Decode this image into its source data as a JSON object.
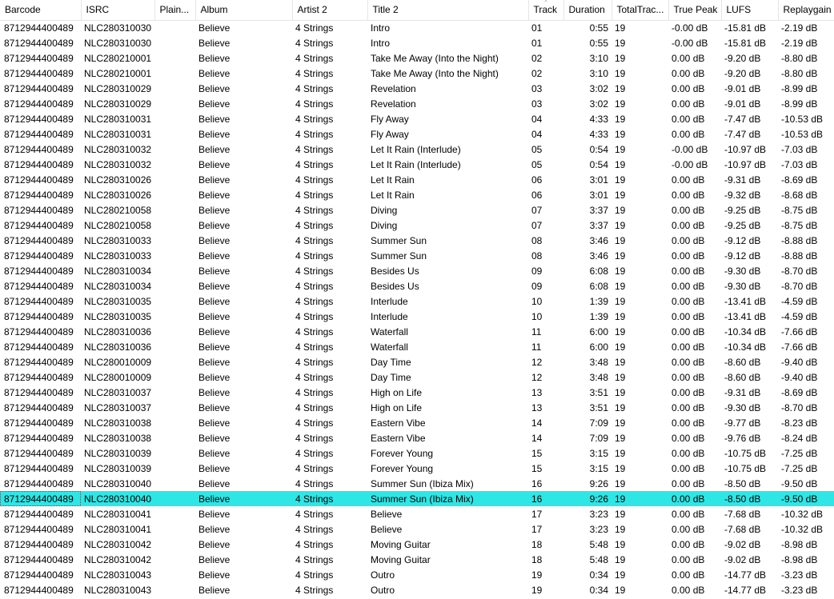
{
  "columns": [
    {
      "key": "barcode",
      "label": "Barcode",
      "width": 101
    },
    {
      "key": "isrc",
      "label": "ISRC",
      "width": 92
    },
    {
      "key": "plain",
      "label": "Plain...",
      "width": 51
    },
    {
      "key": "album",
      "label": "Album",
      "width": 121
    },
    {
      "key": "artist2",
      "label": "Artist 2",
      "width": 94
    },
    {
      "key": "title2",
      "label": "Title 2",
      "width": 201
    },
    {
      "key": "track",
      "label": "Track",
      "width": 44,
      "sorted": true,
      "sort_glyph": "^"
    },
    {
      "key": "duration",
      "label": "Duration",
      "width": 60
    },
    {
      "key": "totaltracks",
      "label": "TotalTrac...",
      "width": 71
    },
    {
      "key": "truepeak",
      "label": "True Peak",
      "width": 66
    },
    {
      "key": "lufs",
      "label": "LUFS",
      "width": 71
    },
    {
      "key": "replaygain",
      "label": "Replaygain",
      "width": 70
    }
  ],
  "selected_row": 31,
  "rows": [
    [
      "8712944400489",
      "NLC280310030",
      "",
      "Believe",
      "4 Strings",
      "Intro",
      "01",
      "0:55",
      "19",
      "-0.00 dB",
      "-15.81 dB",
      "-2.19 dB"
    ],
    [
      "8712944400489",
      "NLC280310030",
      "",
      "Believe",
      "4 Strings",
      "Intro",
      "01",
      "0:55",
      "19",
      "-0.00 dB",
      "-15.81 dB",
      "-2.19 dB"
    ],
    [
      "8712944400489",
      "NLC280210001",
      "",
      "Believe",
      "4 Strings",
      "Take Me Away (Into the Night)",
      "02",
      "3:10",
      "19",
      "0.00 dB",
      "-9.20 dB",
      "-8.80 dB"
    ],
    [
      "8712944400489",
      "NLC280210001",
      "",
      "Believe",
      "4 Strings",
      "Take Me Away (Into the Night)",
      "02",
      "3:10",
      "19",
      "0.00 dB",
      "-9.20 dB",
      "-8.80 dB"
    ],
    [
      "8712944400489",
      "NLC280310029",
      "",
      "Believe",
      "4 Strings",
      "Revelation",
      "03",
      "3:02",
      "19",
      "0.00 dB",
      "-9.01 dB",
      "-8.99 dB"
    ],
    [
      "8712944400489",
      "NLC280310029",
      "",
      "Believe",
      "4 Strings",
      "Revelation",
      "03",
      "3:02",
      "19",
      "0.00 dB",
      "-9.01 dB",
      "-8.99 dB"
    ],
    [
      "8712944400489",
      "NLC280310031",
      "",
      "Believe",
      "4 Strings",
      "Fly Away",
      "04",
      "4:33",
      "19",
      "0.00 dB",
      "-7.47 dB",
      "-10.53 dB"
    ],
    [
      "8712944400489",
      "NLC280310031",
      "",
      "Believe",
      "4 Strings",
      "Fly Away",
      "04",
      "4:33",
      "19",
      "0.00 dB",
      "-7.47 dB",
      "-10.53 dB"
    ],
    [
      "8712944400489",
      "NLC280310032",
      "",
      "Believe",
      "4 Strings",
      "Let It Rain (Interlude)",
      "05",
      "0:54",
      "19",
      "-0.00 dB",
      "-10.97 dB",
      "-7.03 dB"
    ],
    [
      "8712944400489",
      "NLC280310032",
      "",
      "Believe",
      "4 Strings",
      "Let It Rain (Interlude)",
      "05",
      "0:54",
      "19",
      "-0.00 dB",
      "-10.97 dB",
      "-7.03 dB"
    ],
    [
      "8712944400489",
      "NLC280310026",
      "",
      "Believe",
      "4 Strings",
      "Let It Rain",
      "06",
      "3:01",
      "19",
      "0.00 dB",
      "-9.31 dB",
      "-8.69 dB"
    ],
    [
      "8712944400489",
      "NLC280310026",
      "",
      "Believe",
      "4 Strings",
      "Let It Rain",
      "06",
      "3:01",
      "19",
      "0.00 dB",
      "-9.32 dB",
      "-8.68 dB"
    ],
    [
      "8712944400489",
      "NLC280210058",
      "",
      "Believe",
      "4 Strings",
      "Diving",
      "07",
      "3:37",
      "19",
      "0.00 dB",
      "-9.25 dB",
      "-8.75 dB"
    ],
    [
      "8712944400489",
      "NLC280210058",
      "",
      "Believe",
      "4 Strings",
      "Diving",
      "07",
      "3:37",
      "19",
      "0.00 dB",
      "-9.25 dB",
      "-8.75 dB"
    ],
    [
      "8712944400489",
      "NLC280310033",
      "",
      "Believe",
      "4 Strings",
      "Summer Sun",
      "08",
      "3:46",
      "19",
      "0.00 dB",
      "-9.12 dB",
      "-8.88 dB"
    ],
    [
      "8712944400489",
      "NLC280310033",
      "",
      "Believe",
      "4 Strings",
      "Summer Sun",
      "08",
      "3:46",
      "19",
      "0.00 dB",
      "-9.12 dB",
      "-8.88 dB"
    ],
    [
      "8712944400489",
      "NLC280310034",
      "",
      "Believe",
      "4 Strings",
      "Besides Us",
      "09",
      "6:08",
      "19",
      "0.00 dB",
      "-9.30 dB",
      "-8.70 dB"
    ],
    [
      "8712944400489",
      "NLC280310034",
      "",
      "Believe",
      "4 Strings",
      "Besides Us",
      "09",
      "6:08",
      "19",
      "0.00 dB",
      "-9.30 dB",
      "-8.70 dB"
    ],
    [
      "8712944400489",
      "NLC280310035",
      "",
      "Believe",
      "4 Strings",
      "Interlude",
      "10",
      "1:39",
      "19",
      "0.00 dB",
      "-13.41 dB",
      "-4.59 dB"
    ],
    [
      "8712944400489",
      "NLC280310035",
      "",
      "Believe",
      "4 Strings",
      "Interlude",
      "10",
      "1:39",
      "19",
      "0.00 dB",
      "-13.41 dB",
      "-4.59 dB"
    ],
    [
      "8712944400489",
      "NLC280310036",
      "",
      "Believe",
      "4 Strings",
      "Waterfall",
      "11",
      "6:00",
      "19",
      "0.00 dB",
      "-10.34 dB",
      "-7.66 dB"
    ],
    [
      "8712944400489",
      "NLC280310036",
      "",
      "Believe",
      "4 Strings",
      "Waterfall",
      "11",
      "6:00",
      "19",
      "0.00 dB",
      "-10.34 dB",
      "-7.66 dB"
    ],
    [
      "8712944400489",
      "NLC280010009",
      "",
      "Believe",
      "4 Strings",
      "Day Time",
      "12",
      "3:48",
      "19",
      "0.00 dB",
      "-8.60 dB",
      "-9.40 dB"
    ],
    [
      "8712944400489",
      "NLC280010009",
      "",
      "Believe",
      "4 Strings",
      "Day Time",
      "12",
      "3:48",
      "19",
      "0.00 dB",
      "-8.60 dB",
      "-9.40 dB"
    ],
    [
      "8712944400489",
      "NLC280310037",
      "",
      "Believe",
      "4 Strings",
      "High on Life",
      "13",
      "3:51",
      "19",
      "0.00 dB",
      "-9.31 dB",
      "-8.69 dB"
    ],
    [
      "8712944400489",
      "NLC280310037",
      "",
      "Believe",
      "4 Strings",
      "High on Life",
      "13",
      "3:51",
      "19",
      "0.00 dB",
      "-9.30 dB",
      "-8.70 dB"
    ],
    [
      "8712944400489",
      "NLC280310038",
      "",
      "Believe",
      "4 Strings",
      "Eastern Vibe",
      "14",
      "7:09",
      "19",
      "0.00 dB",
      "-9.77 dB",
      "-8.23 dB"
    ],
    [
      "8712944400489",
      "NLC280310038",
      "",
      "Believe",
      "4 Strings",
      "Eastern Vibe",
      "14",
      "7:09",
      "19",
      "0.00 dB",
      "-9.76 dB",
      "-8.24 dB"
    ],
    [
      "8712944400489",
      "NLC280310039",
      "",
      "Believe",
      "4 Strings",
      "Forever Young",
      "15",
      "3:15",
      "19",
      "0.00 dB",
      "-10.75 dB",
      "-7.25 dB"
    ],
    [
      "8712944400489",
      "NLC280310039",
      "",
      "Believe",
      "4 Strings",
      "Forever Young",
      "15",
      "3:15",
      "19",
      "0.00 dB",
      "-10.75 dB",
      "-7.25 dB"
    ],
    [
      "8712944400489",
      "NLC280310040",
      "",
      "Believe",
      "4 Strings",
      "Summer Sun (Ibiza Mix)",
      "16",
      "9:26",
      "19",
      "0.00 dB",
      "-8.50 dB",
      "-9.50 dB"
    ],
    [
      "8712944400489",
      "NLC280310040",
      "",
      "Believe",
      "4 Strings",
      "Summer Sun (Ibiza Mix)",
      "16",
      "9:26",
      "19",
      "0.00 dB",
      "-8.50 dB",
      "-9.50 dB"
    ],
    [
      "8712944400489",
      "NLC280310041",
      "",
      "Believe",
      "4 Strings",
      "Believe",
      "17",
      "3:23",
      "19",
      "0.00 dB",
      "-7.68 dB",
      "-10.32 dB"
    ],
    [
      "8712944400489",
      "NLC280310041",
      "",
      "Believe",
      "4 Strings",
      "Believe",
      "17",
      "3:23",
      "19",
      "0.00 dB",
      "-7.68 dB",
      "-10.32 dB"
    ],
    [
      "8712944400489",
      "NLC280310042",
      "",
      "Believe",
      "4 Strings",
      "Moving Guitar",
      "18",
      "5:48",
      "19",
      "0.00 dB",
      "-9.02 dB",
      "-8.98 dB"
    ],
    [
      "8712944400489",
      "NLC280310042",
      "",
      "Believe",
      "4 Strings",
      "Moving Guitar",
      "18",
      "5:48",
      "19",
      "0.00 dB",
      "-9.02 dB",
      "-8.98 dB"
    ],
    [
      "8712944400489",
      "NLC280310043",
      "",
      "Believe",
      "4 Strings",
      "Outro",
      "19",
      "0:34",
      "19",
      "0.00 dB",
      "-14.77 dB",
      "-3.23 dB"
    ],
    [
      "8712944400489",
      "NLC280310043",
      "",
      "Believe",
      "4 Strings",
      "Outro",
      "19",
      "0:34",
      "19",
      "0.00 dB",
      "-14.77 dB",
      "-3.23 dB"
    ]
  ]
}
